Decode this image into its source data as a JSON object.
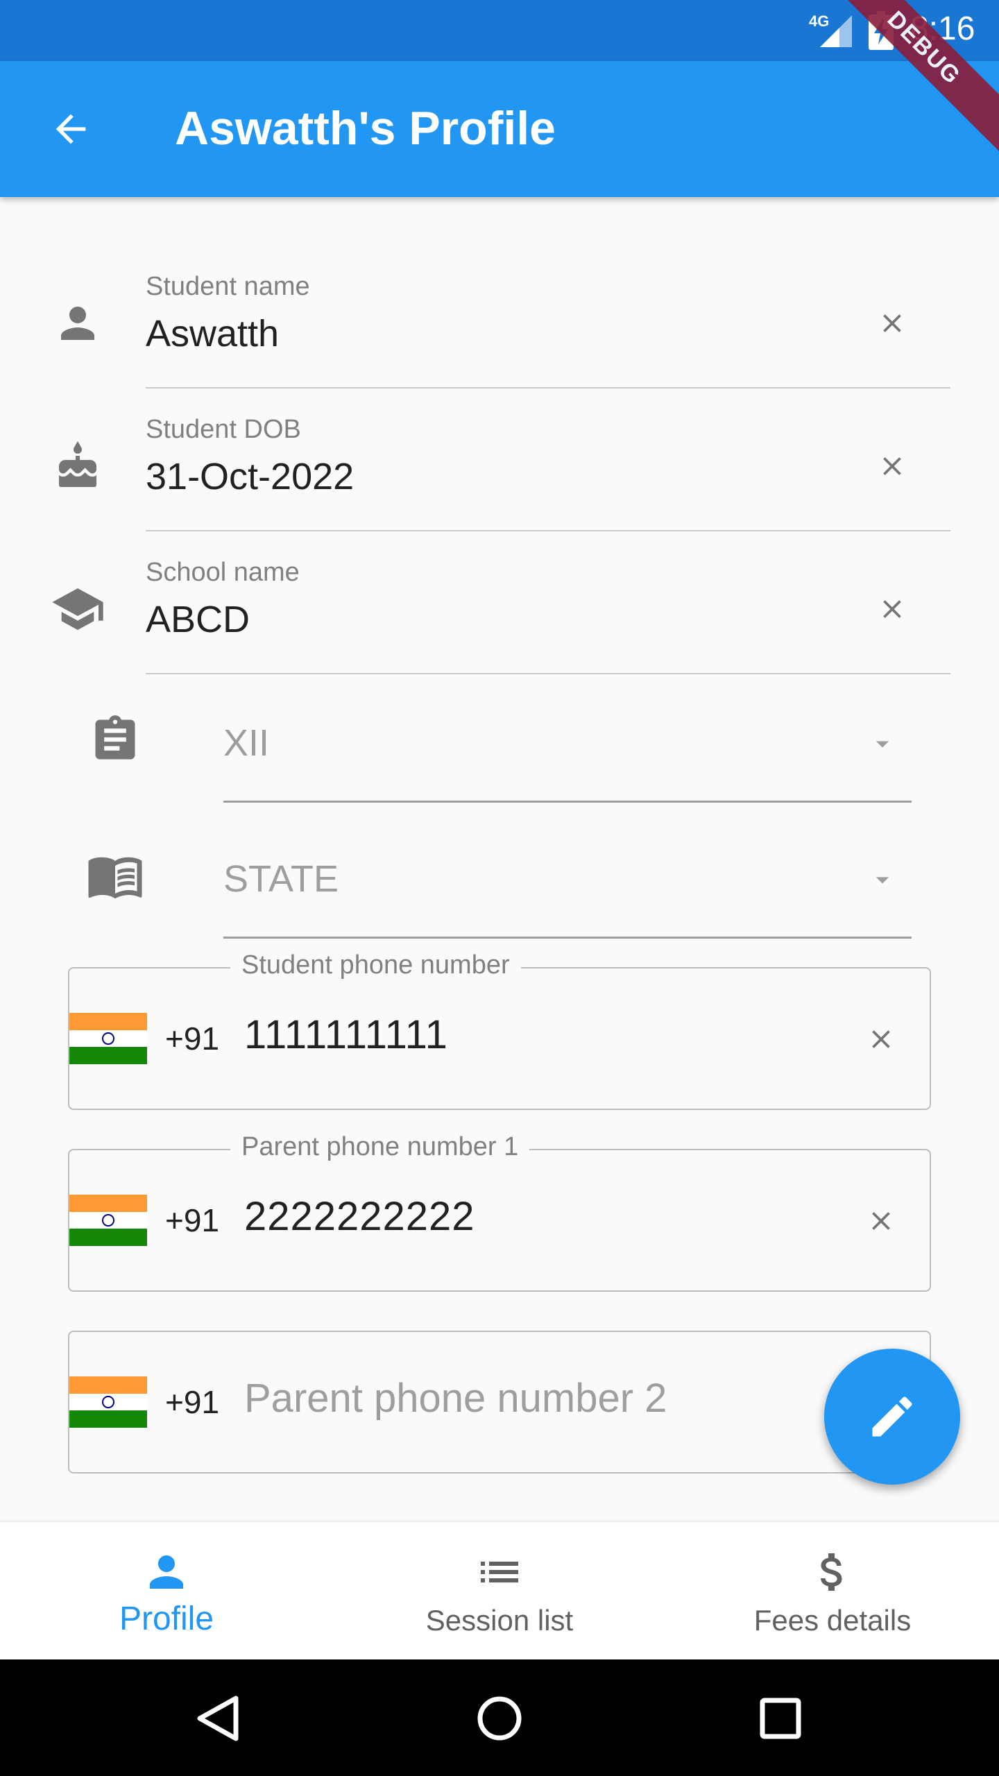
{
  "status_bar": {
    "network": "4G",
    "time": "8:16",
    "debug_banner": "DEBUG"
  },
  "app_bar": {
    "title": "Aswatth's Profile"
  },
  "form": {
    "student_name": {
      "label": "Student name",
      "value": "Aswatth"
    },
    "student_dob": {
      "label": "Student DOB",
      "value": "31-Oct-2022"
    },
    "school_name": {
      "label": "School name",
      "value": "ABCD"
    },
    "grade": {
      "selected": "XII"
    },
    "board": {
      "selected": "STATE"
    },
    "student_phone": {
      "label": "Student phone number",
      "dial_code": "+91",
      "value": "1111111111"
    },
    "parent_phone_1": {
      "label": "Parent phone number 1",
      "dial_code": "+91",
      "value": "2222222222"
    },
    "parent_phone_2": {
      "placeholder": "Parent phone number 2",
      "dial_code": "+91"
    }
  },
  "bottom_nav": {
    "items": [
      {
        "label": "Profile",
        "icon": "person-icon",
        "active": true
      },
      {
        "label": "Session list",
        "icon": "list-icon",
        "active": false
      },
      {
        "label": "Fees details",
        "icon": "dollar-icon",
        "active": false
      }
    ]
  },
  "colors": {
    "primary": "#2196f3",
    "status_bar": "#1976d2",
    "icon_grey": "#757575"
  }
}
